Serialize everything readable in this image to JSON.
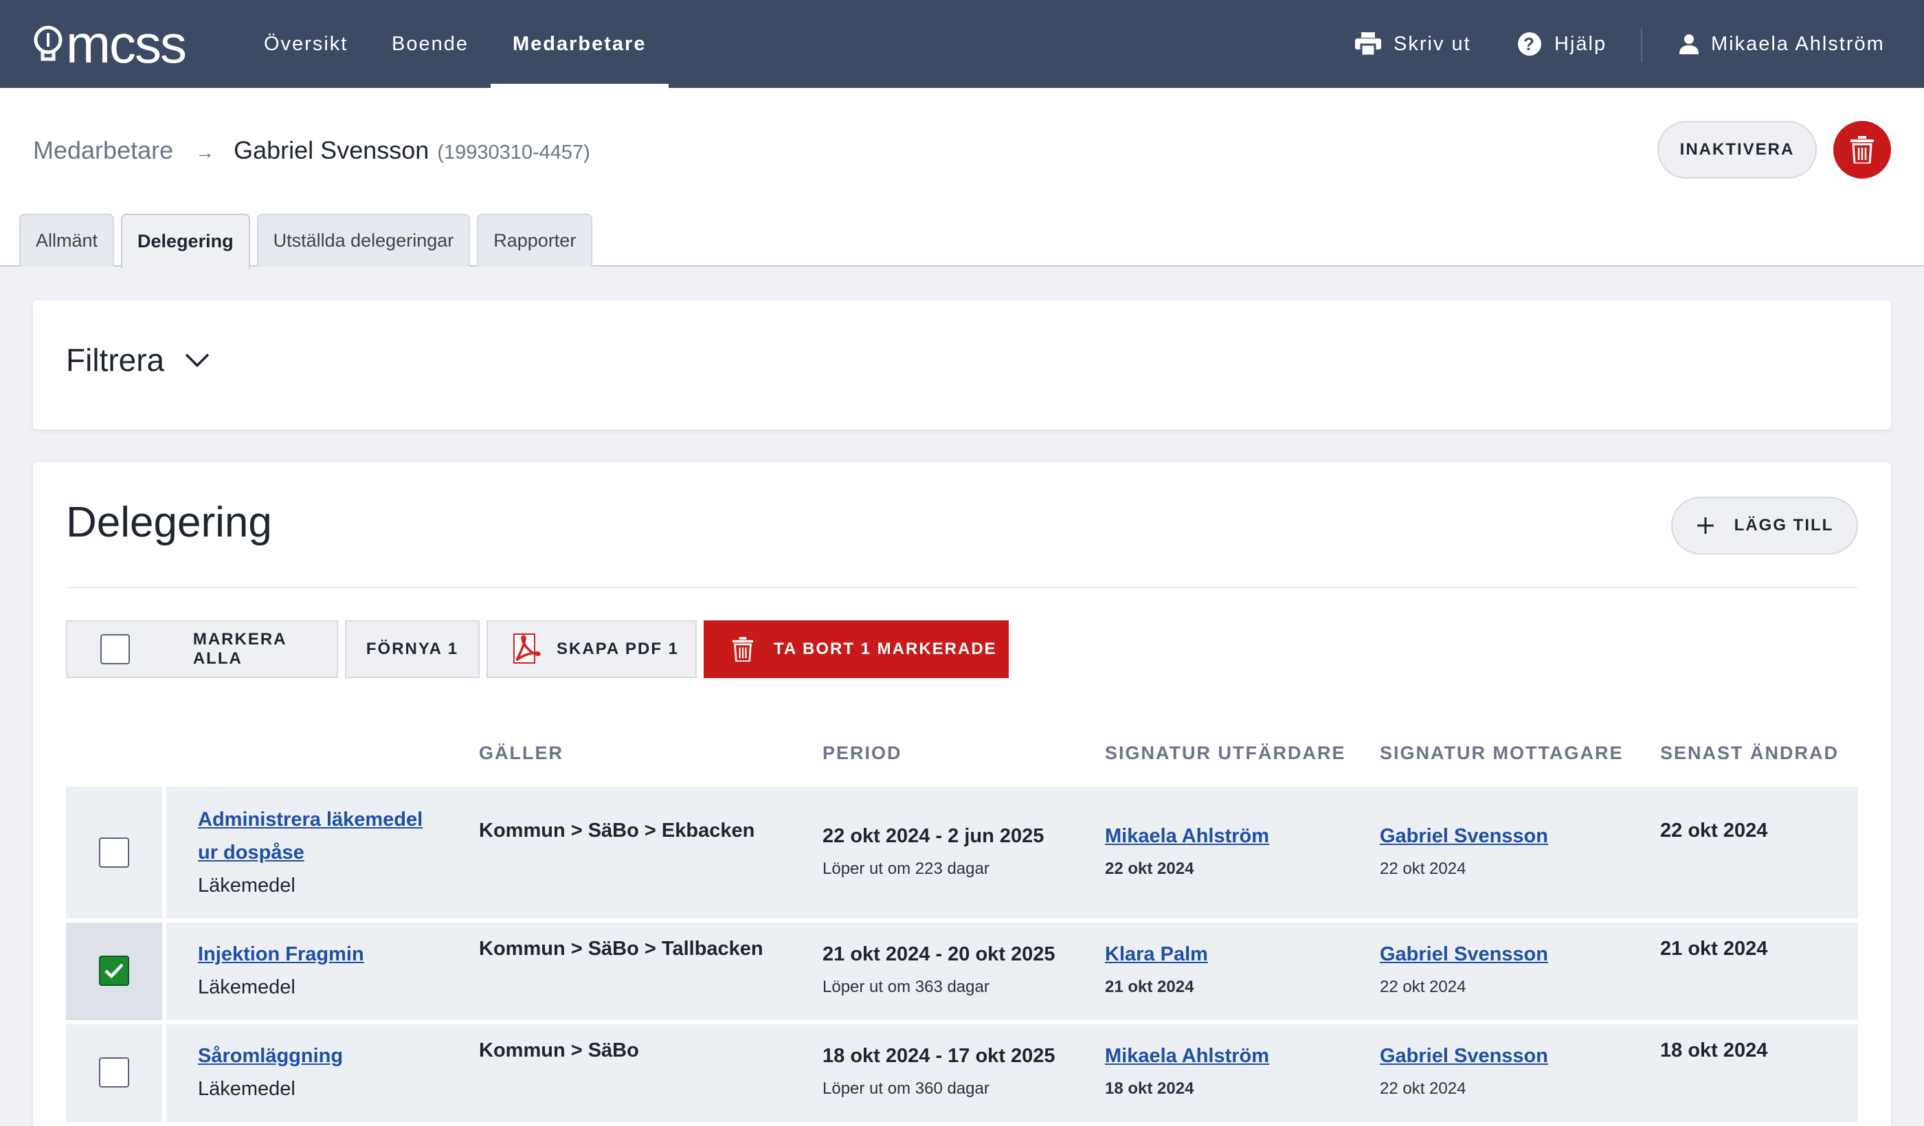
{
  "app": {
    "logo_text": "mcss",
    "nav": [
      "Översikt",
      "Boende",
      "Medarbetare"
    ],
    "active_nav": "Medarbetare",
    "print_label": "Skriv ut",
    "help_label": "Hjälp",
    "user_name": "Mikaela Ahlström"
  },
  "breadcrumb": {
    "parent": "Medarbetare",
    "arrow": "→",
    "name": "Gabriel Svensson",
    "id": "(19930310-4457)"
  },
  "actions": {
    "inactivate_label": "INAKTIVERA"
  },
  "tabs": [
    {
      "label": "Allmänt",
      "active": false
    },
    {
      "label": "Delegering",
      "active": true
    },
    {
      "label": "Utställda delegeringar",
      "active": false
    },
    {
      "label": "Rapporter",
      "active": false
    }
  ],
  "filter": {
    "title": "Filtrera"
  },
  "delegation": {
    "title": "Delegering",
    "add_label": "LÄGG TILL",
    "toolbar": {
      "select_all": "MARKERA ALLA",
      "renew": "FÖRNYA 1",
      "create_pdf": "SKAPA PDF 1",
      "delete_selected": "TA BORT 1 MARKERADE"
    },
    "columns": [
      "GÄLLER",
      "PERIOD",
      "SIGNATUR UTFÄRDARE",
      "SIGNATUR MOTTAGARE",
      "SENAST ÄNDRAD"
    ],
    "rows": [
      {
        "checked": false,
        "name_line1": "Administrera läkemedel",
        "name_line2": "ur dospåse",
        "category": "Läkemedel",
        "applies": "Kommun > SäBo > Ekbacken",
        "period": "22 okt 2024 - 2 jun 2025",
        "expires": "Löper ut om 223 dagar",
        "issuer": "Mikaela Ahlström",
        "issuer_date": "22 okt 2024",
        "receiver": "Gabriel Svensson",
        "receiver_date": "22 okt 2024",
        "changed": "22 okt 2024"
      },
      {
        "checked": true,
        "name_line1": "Injektion Fragmin",
        "category": "Läkemedel",
        "applies": "Kommun > SäBo > Tallbacken",
        "period": "21 okt 2024 - 20 okt 2025",
        "expires": "Löper ut om 363 dagar",
        "issuer": "Klara Palm",
        "issuer_date": "21 okt 2024",
        "receiver": "Gabriel Svensson",
        "receiver_date": "22 okt 2024",
        "changed": "21 okt 2024"
      },
      {
        "checked": false,
        "name_line1": "Såromläggning",
        "category": "Läkemedel",
        "applies": "Kommun > SäBo",
        "period": "18 okt 2024 - 17 okt 2025",
        "expires": "Löper ut om 360 dagar",
        "issuer": "Mikaela Ahlström",
        "issuer_date": "18 okt 2024",
        "receiver": "Gabriel Svensson",
        "receiver_date": "22 okt 2024",
        "changed": "18 okt 2024"
      }
    ]
  },
  "colors": {
    "topbar": "#3d4a64",
    "danger": "#c81a1a",
    "link": "#1f4fa6",
    "check": "#1b8a2e"
  }
}
